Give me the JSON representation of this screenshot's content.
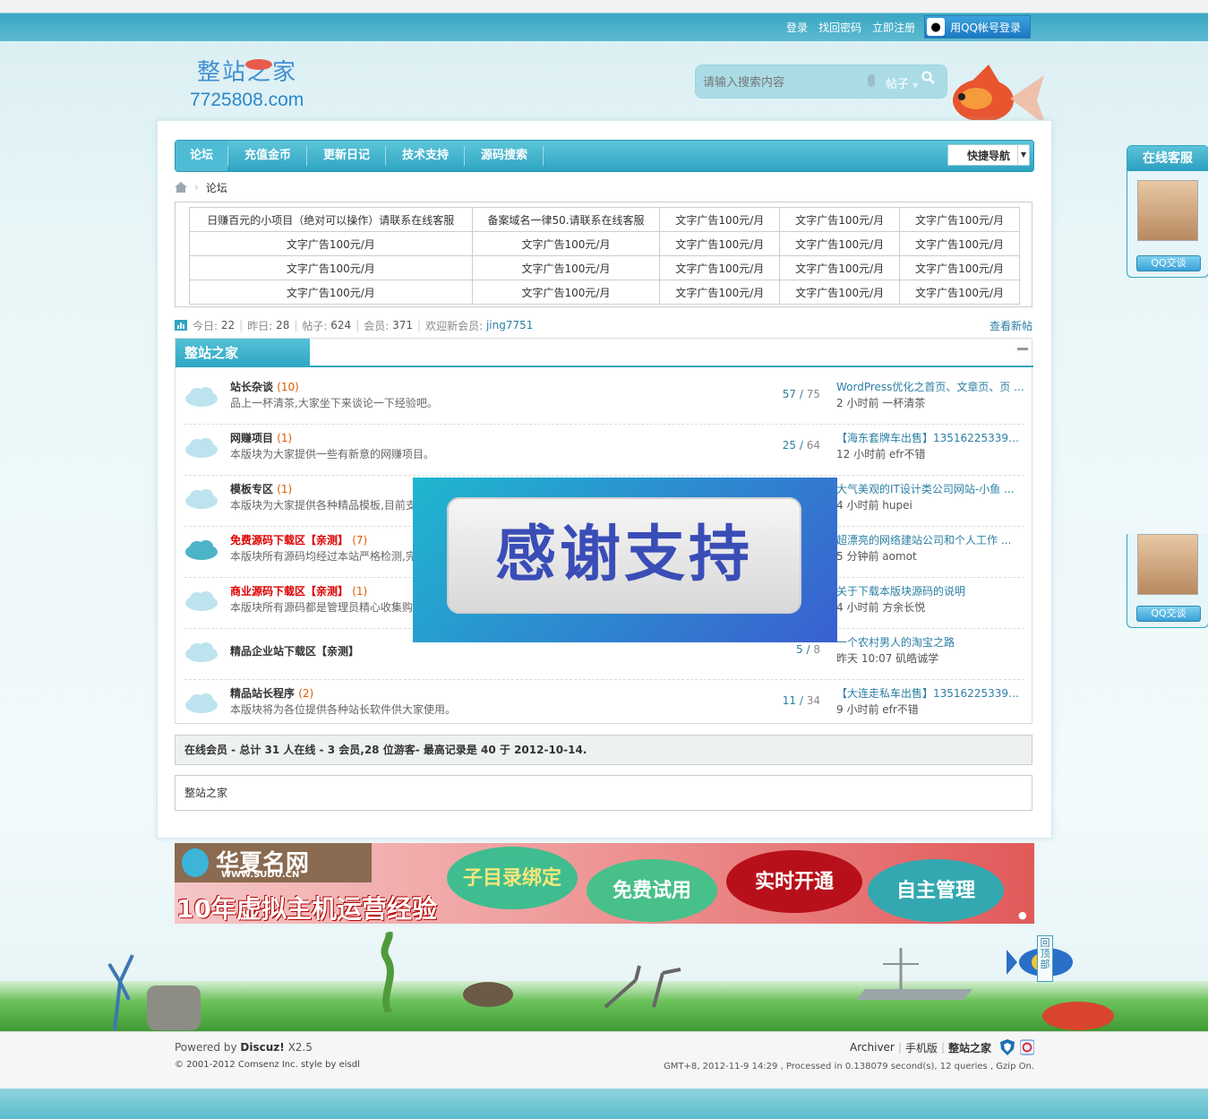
{
  "topbar": {
    "links": [
      "登录",
      "找回密码",
      "立即注册"
    ],
    "qq_login": "用QQ帐号登录"
  },
  "logo": {
    "name_cn": "整站之家",
    "url": "7725808.com"
  },
  "search": {
    "placeholder": "请输入搜索内容",
    "type": "帖子"
  },
  "nav": {
    "items": [
      "论坛",
      "充值金币",
      "更新日记",
      "技术支持",
      "源码搜索"
    ],
    "quick_nav": "快捷导航"
  },
  "breadcrumb": {
    "current": "论坛"
  },
  "ads": {
    "rows": [
      [
        "日赚百元的小项目（绝对可以操作）请联系在线客服",
        "备案域名一律50.请联系在线客服",
        "文字广告100元/月",
        "文字广告100元/月",
        "文字广告100元/月"
      ],
      [
        "文字广告100元/月",
        "文字广告100元/月",
        "文字广告100元/月",
        "文字广告100元/月",
        "文字广告100元/月"
      ],
      [
        "文字广告100元/月",
        "文字广告100元/月",
        "文字广告100元/月",
        "文字广告100元/月",
        "文字广告100元/月"
      ],
      [
        "文字广告100元/月",
        "文字广告100元/月",
        "文字广告100元/月",
        "文字广告100元/月",
        "文字广告100元/月"
      ]
    ]
  },
  "stats": {
    "today_label": "今日:",
    "today": "22",
    "yesterday_label": "昨日:",
    "yesterday": "28",
    "posts_label": "帖子:",
    "posts": "624",
    "members_label": "会员:",
    "members": "371",
    "welcome_label": "欢迎新会员:",
    "new_member": "jing7751",
    "view_new": "查看新帖"
  },
  "category": {
    "title": "整站之家"
  },
  "forums": [
    {
      "name": "站长杂谈",
      "count": "(10)",
      "desc": "品上一杯清茶,大家坐下来谈论一下经验吧。",
      "threads": "57",
      "posts": "75",
      "last_title": "WordPress优化之首页、文章页、页 ...",
      "last_time": "2 小时前 一杯清茶",
      "red": false
    },
    {
      "name": "网赚项目",
      "count": "(1)",
      "desc": "本版块为大家提供一些有新意的网赚项目。",
      "threads": "25",
      "posts": "64",
      "last_title": "【海东套牌车出售】13516225339【 ...",
      "last_time": "12 小时前 efr不错",
      "red": false
    },
    {
      "name": "模板专区",
      "count": "(1)",
      "desc": "本版块为大家提供各种精品模板,目前支",
      "threads": "",
      "posts": "",
      "last_title": "大气美观的IT设计类公司网站-小鱼 ...",
      "last_time": "4 小时前 hupei",
      "red": false
    },
    {
      "name": "免费源码下载区【亲测】",
      "count": "(7)",
      "desc": "本版块所有源码均经过本站严格检测,完",
      "threads": "",
      "posts": "",
      "last_title": "超漂亮的网络建站公司和个人工作 ...",
      "last_time": "5 分钟前 aomot",
      "red": true
    },
    {
      "name": "商业源码下载区【亲测】",
      "count": "(1)",
      "desc": "本版块所有源码都是管理员精心收集购",
      "threads": "",
      "posts": "",
      "last_title": "关于下载本版块源码的说明",
      "last_time": "4 小时前 方余长悦",
      "red": true
    },
    {
      "name": "精品企业站下载区【亲测】",
      "count": "",
      "desc": "",
      "threads": "5",
      "posts": "8",
      "last_title": "一个农村男人的淘宝之路",
      "last_time": "昨天 10:07 矶皓诚学",
      "red": false
    },
    {
      "name": "精品站长程序",
      "count": "(2)",
      "desc": "本版块将为各位提供各种站长软件供大家使用。",
      "threads": "11",
      "posts": "34",
      "last_title": "【大连走私车出售】13516225339【 ...",
      "last_time": "9 小时前 efr不错",
      "red": false
    }
  ],
  "overlay": {
    "text": "感谢支持"
  },
  "online": {
    "text": "在线会员 - 总计 31 人在线 - 3 会员,28 位游客- 最高记录是 40 于 2012-10-14."
  },
  "friendlink": {
    "text": "整站之家"
  },
  "banner": {
    "brand": "华夏名网",
    "url": "WWW.SUDU.CN",
    "slogan": "10年虚拟主机运营经验",
    "bubbles": [
      "子目录绑定",
      "免费试用",
      "实时开通",
      "自主管理"
    ]
  },
  "service": {
    "title": "在线客服",
    "qq_button": "QQ交谈"
  },
  "backtop": {
    "text": "回顶部"
  },
  "footer": {
    "powered_prefix": "Powered by",
    "powered_brand": "Discuz!",
    "powered_version": "X2.5",
    "copyright": "© 2001-2012 Comsenz Inc. style by eisdl",
    "links": [
      "Archiver",
      "手机版",
      "整站之家"
    ],
    "gmt": "GMT+8, 2012-11-9 14:29 , Processed in 0.138079 second(s), 12 queries , Gzip On."
  },
  "colors": {
    "accent": "#2ea5c3",
    "red_forum": "#dd0000",
    "link": "#2c7fa3"
  }
}
